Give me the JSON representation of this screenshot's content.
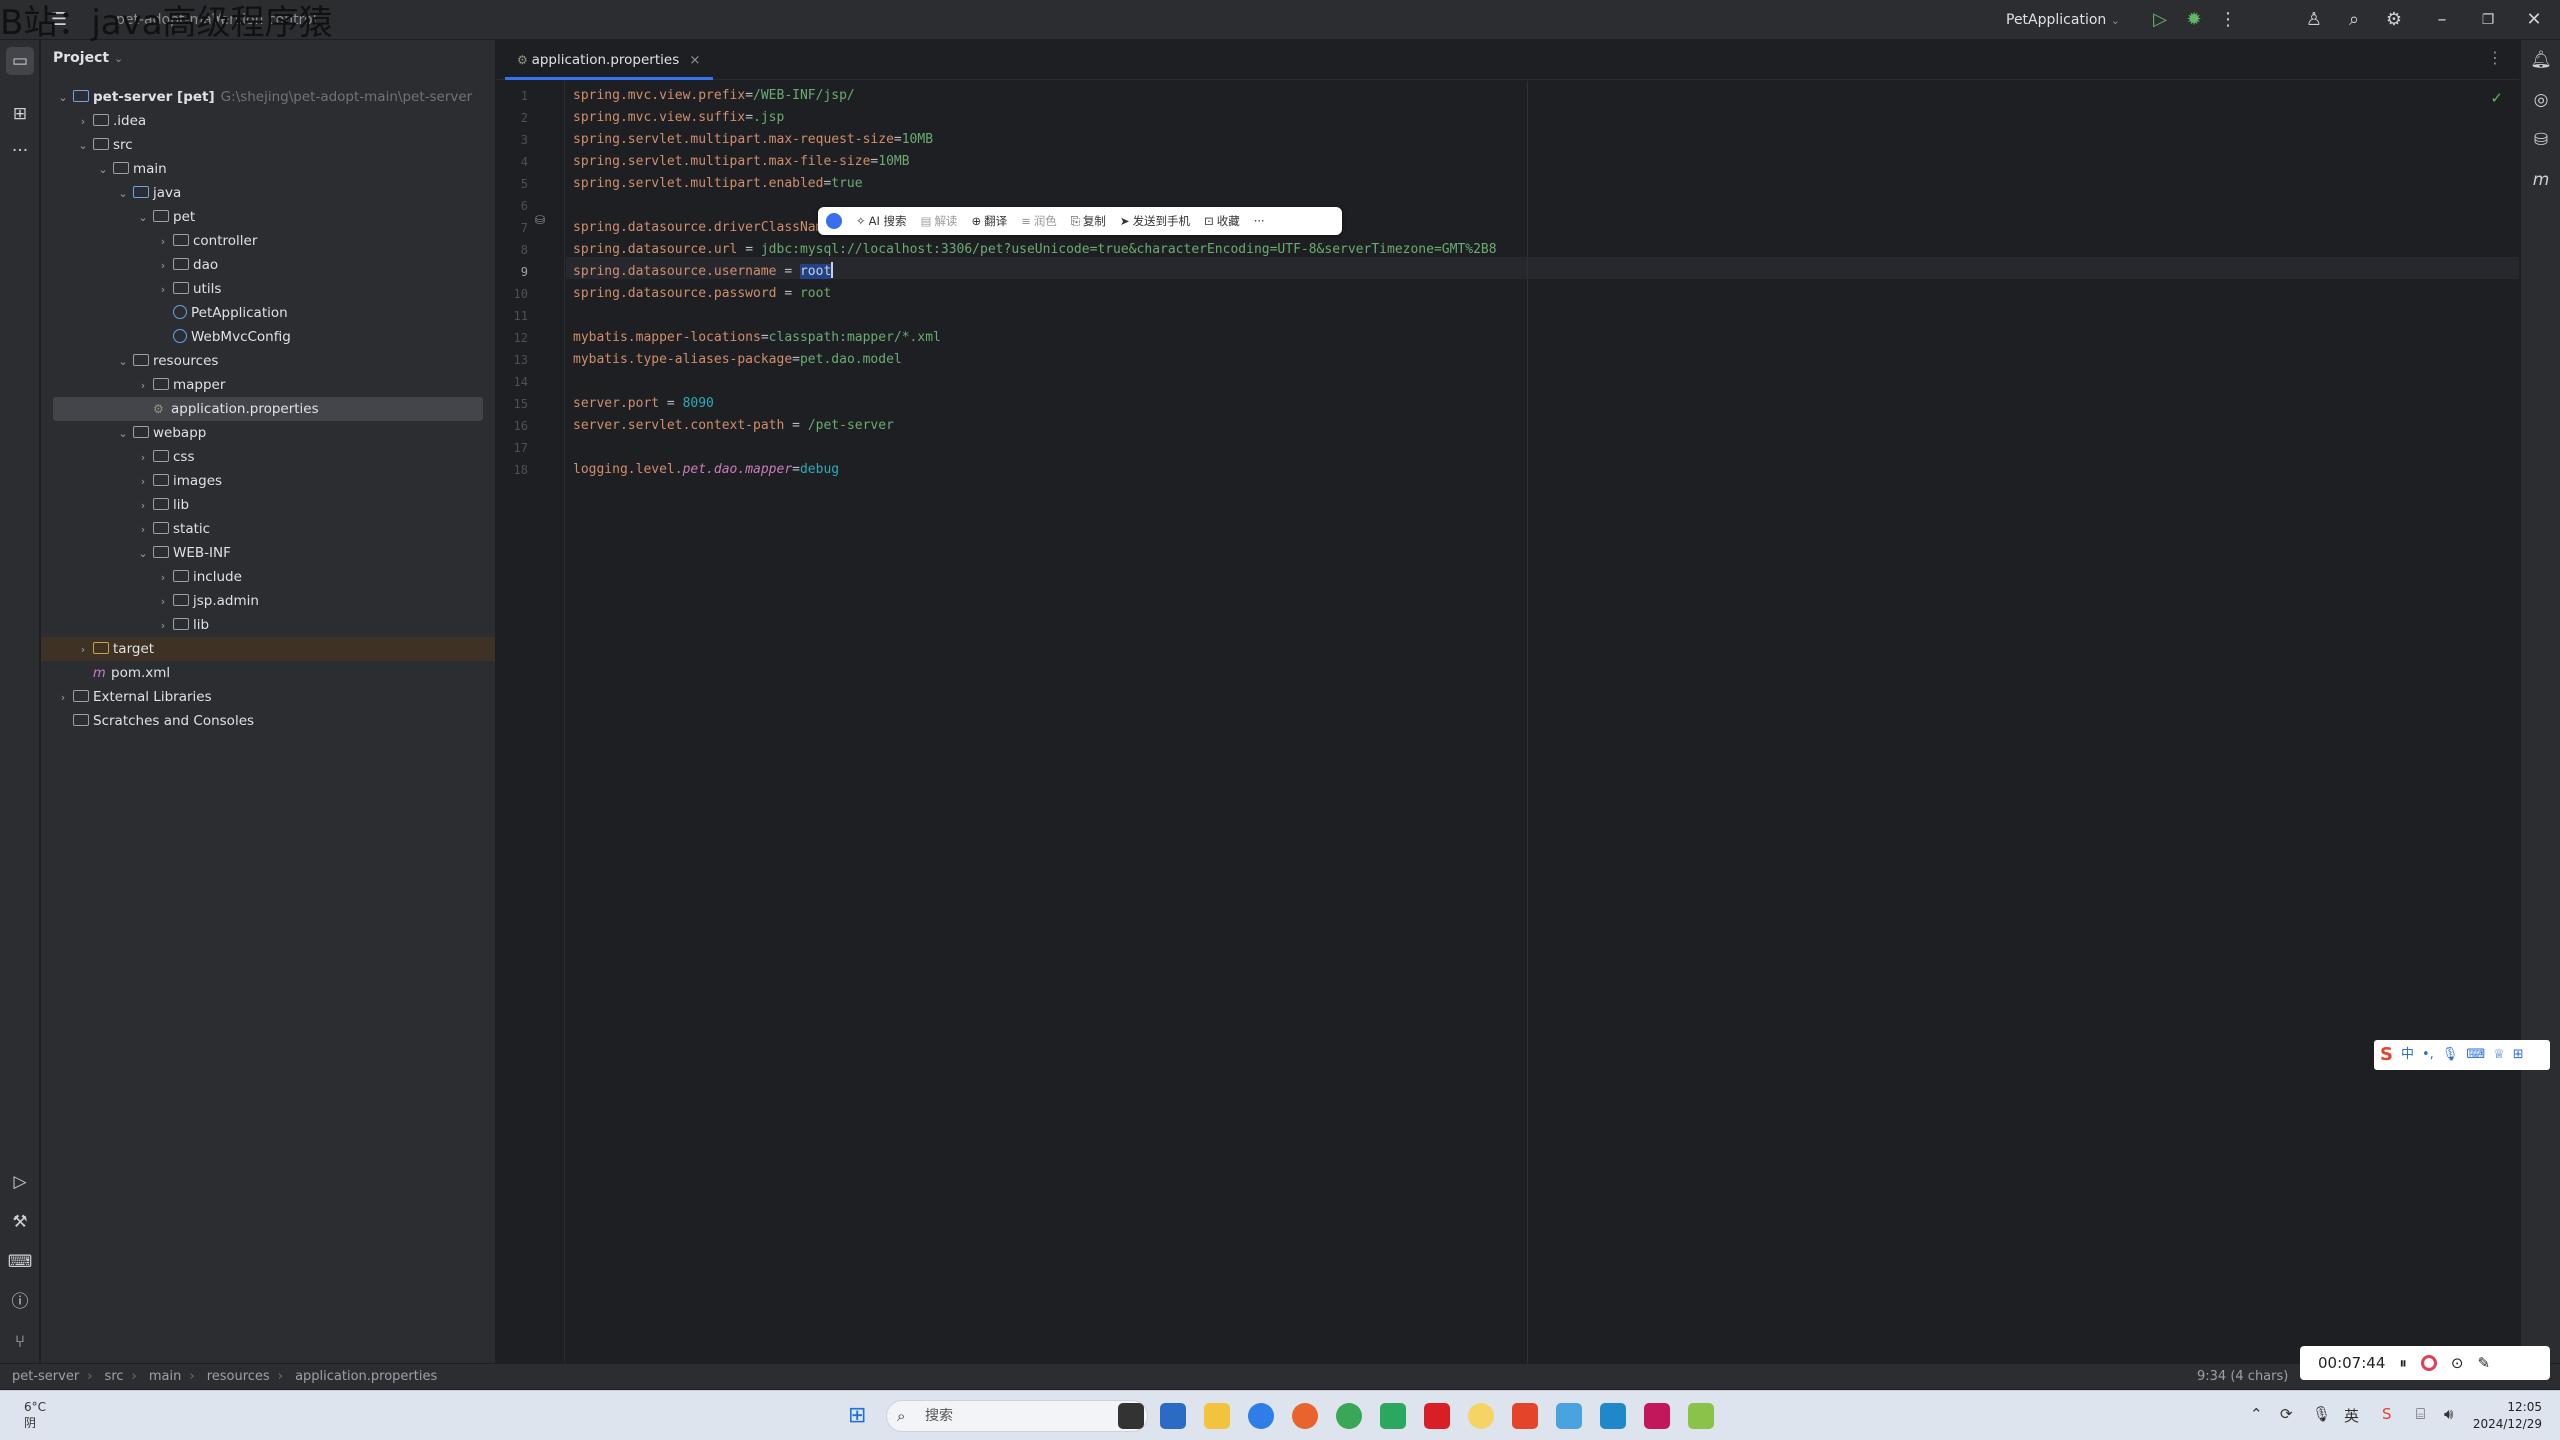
{
  "watermark": "B站：java高级程序猿",
  "titlebar": {
    "project_name": "pet-adopt-main",
    "branch": "Version control",
    "run_config": "PetApplication"
  },
  "project_panel": {
    "header": "Project",
    "rows": [
      {
        "label": "pet-server [pet]",
        "hint": "G:\\shejing\\pet-adopt-main\\pet-server"
      },
      {
        "label": ".idea"
      },
      {
        "label": "src"
      },
      {
        "label": "main"
      },
      {
        "label": "java"
      },
      {
        "label": "pet"
      },
      {
        "label": "controller"
      },
      {
        "label": "dao"
      },
      {
        "label": "utils"
      },
      {
        "label": "PetApplication"
      },
      {
        "label": "WebMvcConfig"
      },
      {
        "label": "resources"
      },
      {
        "label": "mapper"
      },
      {
        "label": "application.properties"
      },
      {
        "label": "webapp"
      },
      {
        "label": "css"
      },
      {
        "label": "images"
      },
      {
        "label": "lib"
      },
      {
        "label": "static"
      },
      {
        "label": "WEB-INF"
      },
      {
        "label": "include"
      },
      {
        "label": "jsp.admin"
      },
      {
        "label": "lib"
      },
      {
        "label": "target"
      },
      {
        "label": "pom.xml"
      },
      {
        "label": "External Libraries"
      },
      {
        "label": "Scratches and Consoles"
      }
    ]
  },
  "editor": {
    "tab_label": "application.properties",
    "line_numbers": [
      "1",
      "2",
      "3",
      "4",
      "5",
      "6",
      "7",
      "8",
      "9",
      "10",
      "11",
      "12",
      "13",
      "14",
      "15",
      "16",
      "17",
      "18"
    ],
    "lines": [
      {
        "key": "spring.mvc.view.prefix",
        "sep": "=",
        "value": "/WEB-INF/jsp/"
      },
      {
        "key": "spring.mvc.view.suffix",
        "sep": "=",
        "value": ".jsp"
      },
      {
        "key": "spring.servlet.multipart.max-request-size",
        "sep": "=",
        "value": "10MB"
      },
      {
        "key": "spring.servlet.multipart.max-file-size",
        "sep": "=",
        "value": "10MB"
      },
      {
        "key": "spring.servlet.multipart.enabled",
        "sep": "=",
        "value": "true"
      },
      {
        "key": "",
        "sep": "",
        "value": ""
      },
      {
        "key": "spring.datasource.driverClassNam",
        "sep": "",
        "value": ""
      },
      {
        "key": "spring.datasource.url",
        "sep": " = ",
        "value": "jdbc:mysql://localhost:3306/pet?useUnicode=true&characterEncoding=UTF-8&serverTimezone=GMT%2B8"
      },
      {
        "key": "spring.datasource.username",
        "sep": " = ",
        "value": "root"
      },
      {
        "key": "spring.datasource.password",
        "sep": " = ",
        "value": "root"
      },
      {
        "key": "",
        "sep": "",
        "value": ""
      },
      {
        "key": "mybatis.mapper-locations",
        "sep": "=",
        "value": "classpath:mapper/*.xml"
      },
      {
        "key": "mybatis.type-aliases-package",
        "sep": "=",
        "value": "pet.dao.model"
      },
      {
        "key": "",
        "sep": "",
        "value": ""
      },
      {
        "key": "server.port",
        "sep": " = ",
        "value": "8090"
      },
      {
        "key": "server.servlet.context-path",
        "sep": " = ",
        "value": "/pet-server"
      },
      {
        "key": "",
        "sep": "",
        "value": ""
      },
      {
        "key": "logging.level.pet.dao.mapper",
        "sep": "=",
        "value": "debug"
      }
    ],
    "logging_key_plain": "logging.level.",
    "logging_key_ital": "pet.dao.mapper"
  },
  "float_toolbar": {
    "items": [
      "AI 搜索",
      "解读",
      "翻译",
      "润色",
      "复制",
      "发送到手机",
      "收藏",
      "···"
    ]
  },
  "statusbar": {
    "breadcrumb": [
      "pet-server",
      "src",
      "main",
      "resources",
      "application.properties"
    ],
    "caret": "9:34 (4 chars)"
  },
  "ime": {
    "label": "中"
  },
  "recorder": {
    "time": "00:07:44"
  },
  "taskbar": {
    "weather_temp": "6°C",
    "weather_cond": "阴",
    "search_placeholder": "搜索",
    "time": "12:05",
    "date": "2024/12/29"
  }
}
